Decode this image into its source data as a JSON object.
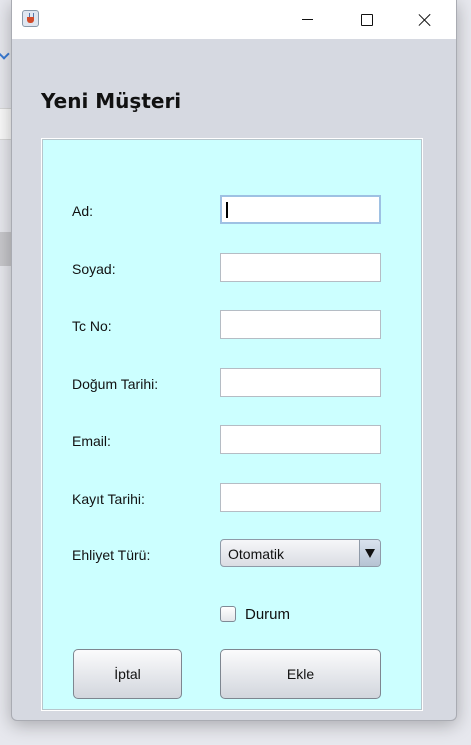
{
  "dialog": {
    "heading": "Yeni Müşteri"
  },
  "form": {
    "fields": [
      {
        "label": "Ad:",
        "value": ""
      },
      {
        "label": "Soyad:",
        "value": ""
      },
      {
        "label": "Tc No:",
        "value": ""
      },
      {
        "label": "Doğum Tarihi:",
        "value": ""
      },
      {
        "label": "Email:",
        "value": ""
      },
      {
        "label": "Kayıt Tarihi:",
        "value": ""
      }
    ],
    "license": {
      "label": "Ehliyet Türü:",
      "selected": "Otomatik"
    },
    "status": {
      "label": "Durum",
      "checked": false
    }
  },
  "buttons": {
    "cancel": "İptal",
    "add": "Ekle"
  },
  "colors": {
    "panel_background": "#ccffff",
    "window_background": "#d6d9e1"
  },
  "icons": {
    "app": "java-app-icon",
    "minimize": "minimize-icon",
    "maximize": "maximize-icon",
    "close": "close-icon",
    "dropdown": "triangle-down-icon"
  }
}
